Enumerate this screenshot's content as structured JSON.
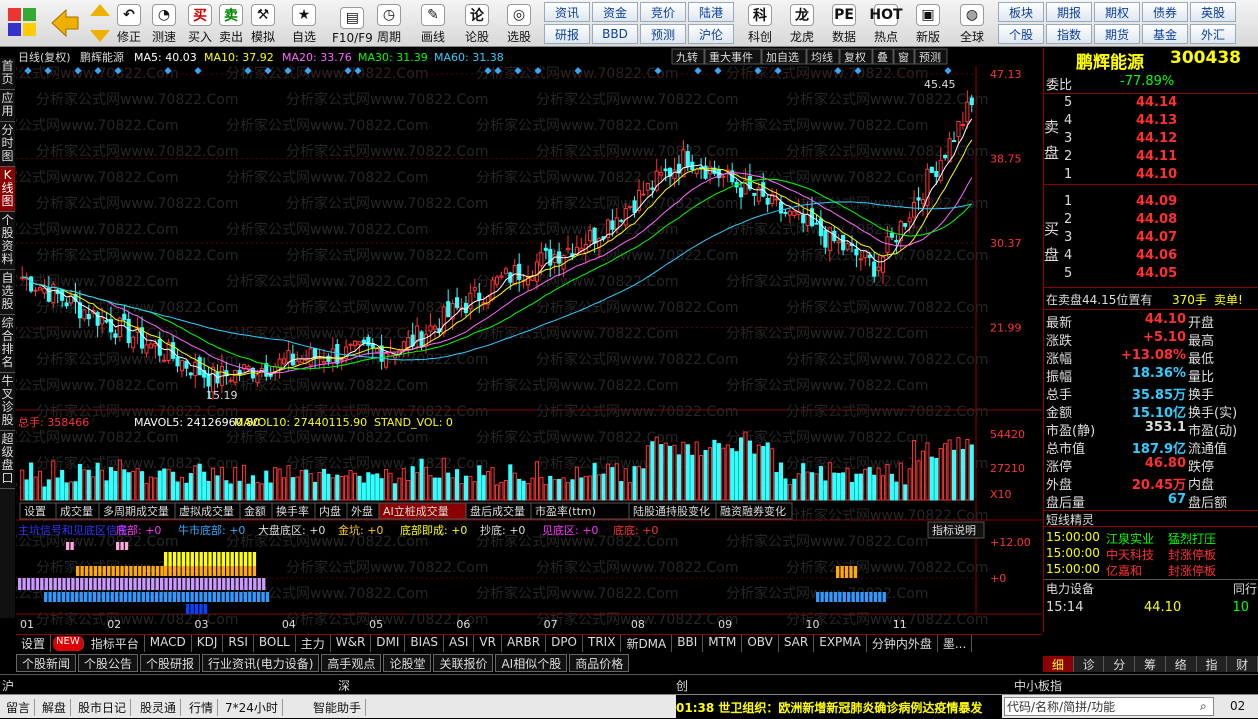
{
  "toolbar": {
    "buttons": [
      {
        "label": "修正",
        "icon": "undo-icon",
        "glyph": "↶",
        "x": 117
      },
      {
        "label": "测速",
        "icon": "speed-icon",
        "glyph": "◔",
        "x": 152
      },
      {
        "label": "买入",
        "icon": "buy-icon",
        "glyph": "买",
        "x": 188,
        "color": "#d00000"
      },
      {
        "label": "卖出",
        "icon": "sell-icon",
        "glyph": "卖",
        "x": 219,
        "color": "#008800"
      },
      {
        "label": "模拟",
        "icon": "simulate-icon",
        "glyph": "⚒",
        "x": 251
      },
      {
        "label": "自选",
        "icon": "watchlist-icon",
        "glyph": "★",
        "x": 292
      },
      {
        "label": "F10/F9",
        "icon": "f10-icon",
        "glyph": "▤",
        "x": 332
      },
      {
        "label": "周期",
        "icon": "period-icon",
        "glyph": "◷",
        "x": 377
      },
      {
        "label": "画线",
        "icon": "draw-icon",
        "glyph": "✎",
        "x": 421
      },
      {
        "label": "论股",
        "icon": "discuss-icon",
        "glyph": "论",
        "x": 465
      },
      {
        "label": "选股",
        "icon": "select-icon",
        "glyph": "◎",
        "x": 507
      },
      {
        "label": "科创",
        "icon": "kechuang-icon",
        "glyph": "科",
        "x": 748
      },
      {
        "label": "龙虎",
        "icon": "dragon-icon",
        "glyph": "龙",
        "x": 790
      },
      {
        "label": "数据",
        "icon": "data-icon",
        "glyph": "PE",
        "x": 832
      },
      {
        "label": "热点",
        "icon": "hot-icon",
        "glyph": "HOT",
        "x": 874
      },
      {
        "label": "新版",
        "icon": "new-version-icon",
        "glyph": "▣",
        "x": 916
      },
      {
        "label": "全球",
        "icon": "globe-icon",
        "glyph": "◍",
        "x": 960
      }
    ],
    "grid1": [
      "资讯",
      "资金",
      "竞价",
      "陆港",
      "研报",
      "BBD",
      "预测",
      "沪伦"
    ],
    "grid2": [
      "板块",
      "期报",
      "期权",
      "债券",
      "英股",
      "个股",
      "指数",
      "期货",
      "基金",
      "外汇"
    ]
  },
  "vtabs": [
    "首页",
    "应用",
    "分时图",
    "K线图",
    "个股资料",
    "自选股",
    "综合排名",
    "牛叉诊股",
    "超级盘口"
  ],
  "chart": {
    "info": {
      "label": "日线(复权)",
      "name": "鹏辉能源",
      "ma5": "MA5: 40.03",
      "ma10": "MA10: 37.92",
      "ma20": "MA20: 33.76",
      "ma30": "MA30: 31.39",
      "ma60": "MA60: 31.38"
    },
    "top_buttons": [
      "九转",
      "重大事件",
      "加自选",
      "均线",
      "复权",
      "叠",
      "窗",
      "预测"
    ],
    "price_ticks": [
      "47.13",
      "38.75",
      "30.37",
      "21.99"
    ],
    "high_label": "45.45",
    "low_label": "15.19",
    "vol_info": {
      "total": "总手: 358466",
      "mavol5": "MAVOL5: 24126960.80",
      "mavol10": "MAVOL10: 27440115.90",
      "stand": "STAND_VOL: 0"
    },
    "vol_ticks": [
      "54420",
      "27210",
      "X10"
    ],
    "vol_tabs": [
      "设置",
      "成交量",
      "多周期成交量",
      "虚拟成交量",
      "金额",
      "换手率",
      "内盘",
      "外盘",
      "AI立桩成交量",
      "盘后成交量",
      "市盈率(ttm)",
      "陆股通持股变化",
      "融资融券变化"
    ],
    "ind_info": {
      "title": "主坑信号和见底区信号",
      "dixi": "底部: +0",
      "niushi": "牛市底部: +0",
      "dapan": "大盘底区: +0",
      "jinkeng": "金坑: +0",
      "dibu": "底部即成: +0",
      "chaodi": "抄底: +0",
      "jiandi": "见底区: +0",
      "dipo": "底底: +0"
    },
    "ind_btn": "指标说明",
    "ind_ticks": [
      "+12.00",
      "+0"
    ],
    "x_labels": [
      "01",
      "02",
      "03",
      "04",
      "05",
      "06",
      "07",
      "08",
      "09",
      "10",
      "11"
    ]
  },
  "chart_data": {
    "type": "candlestick",
    "title": "鹏辉能源",
    "x": [
      "01",
      "02",
      "03",
      "04",
      "05",
      "06",
      "07",
      "08",
      "09",
      "10",
      "11"
    ],
    "close_monthly": [
      27.0,
      22.0,
      17.0,
      19.0,
      20.0,
      26.5,
      31.0,
      39.0,
      33.5,
      28.0,
      44.1
    ],
    "ylim": [
      15.19,
      47.13
    ],
    "ma_colors": {
      "ma5": "#ffffff",
      "ma10": "#ffff00",
      "ma20": "#ff66ff",
      "ma30": "#00ff00",
      "ma60": "#33ccff"
    }
  },
  "quote": {
    "name": "鹏辉能源",
    "code": "300438",
    "weibi_label": "委比",
    "weibi": "-77.89%",
    "sell_label": "卖盘",
    "buy_label": "买盘",
    "asks": [
      {
        "lvl": "5",
        "p": "44.14"
      },
      {
        "lvl": "4",
        "p": "44.13"
      },
      {
        "lvl": "3",
        "p": "44.12"
      },
      {
        "lvl": "2",
        "p": "44.11"
      },
      {
        "lvl": "1",
        "p": "44.10"
      }
    ],
    "bids": [
      {
        "lvl": "1",
        "p": "44.09"
      },
      {
        "lvl": "2",
        "p": "44.08"
      },
      {
        "lvl": "3",
        "p": "44.07"
      },
      {
        "lvl": "4",
        "p": "44.06"
      },
      {
        "lvl": "5",
        "p": "44.05"
      }
    ],
    "notice": "在卖盘44.15位置有",
    "notice_qty": "370手",
    "notice_tag": "卖单!",
    "stats": [
      {
        "l": "最新",
        "v": "44.10",
        "c": "#ff3030",
        "l2": "开盘"
      },
      {
        "l": "涨跌",
        "v": "+5.10",
        "c": "#ff3030",
        "l2": "最高"
      },
      {
        "l": "涨幅",
        "v": "+13.08%",
        "c": "#ff3030",
        "l2": "最低"
      },
      {
        "l": "振幅",
        "v": "18.36%",
        "c": "#33ccff",
        "l2": "量比"
      },
      {
        "l": "总手",
        "v": "35.85万",
        "c": "#33ccff",
        "l2": "换手"
      },
      {
        "l": "金额",
        "v": "15.10亿",
        "c": "#33ccff",
        "l2": "换手(实)"
      },
      {
        "l": "市盈(静)",
        "v": "353.1",
        "c": "#ddd",
        "l2": "市盈(动)"
      },
      {
        "l": "总市值",
        "v": "187.9亿",
        "c": "#33ccff",
        "l2": "流通值"
      },
      {
        "l": "涨停",
        "v": "46.80",
        "c": "#ff3030",
        "l2": "跌停"
      },
      {
        "l": "外盘",
        "v": "20.45万",
        "c": "#ff3030",
        "l2": "内盘"
      },
      {
        "l": "盘后量",
        "v": "67",
        "c": "#33ccff",
        "l2": "盘后额"
      }
    ],
    "news_title": "短线精灵",
    "news": [
      {
        "t": "15:00:00",
        "n": "江泉实业",
        "e": "猛烈打压",
        "c": "#00ff00"
      },
      {
        "t": "15:00:00",
        "n": "中天科技",
        "e": "封涨停板",
        "c": "#ff3030"
      },
      {
        "t": "15:00:00",
        "n": "亿嘉和",
        "e": "封涨停板",
        "c": "#ff3030"
      }
    ],
    "sector": "电力设备",
    "sector2": "同行",
    "tick": {
      "time": "15:14",
      "price": "44.10",
      "qty": "10"
    },
    "btabs": [
      "细",
      "诊",
      "分",
      "筹",
      "络",
      "指",
      "财"
    ]
  },
  "bottom": {
    "indicators": [
      "设置",
      "指标平台",
      "MACD",
      "KDJ",
      "RSI",
      "BOLL",
      "主力",
      "W&R",
      "DMI",
      "BIAS",
      "ASI",
      "VR",
      "ARBR",
      "DPO",
      "TRIX",
      "新DMA",
      "BBI",
      "MTM",
      "OBV",
      "SAR",
      "EXPMA",
      "分钟内外盘",
      "墨..."
    ],
    "new_badge": "NEW",
    "news_tabs": [
      "个股新闻",
      "个股公告",
      "个股研报",
      "行业资讯(电力设备)",
      "高手观点",
      "论股堂",
      "关联报价",
      "AI相似个股",
      "商品价格"
    ]
  },
  "status": {
    "sh": "沪",
    "sz": "深",
    "cy": "创",
    "right": "中小板指"
  },
  "foot": {
    "tabs": [
      "留言",
      "解盘",
      "股市日记",
      "股灵通",
      "行情",
      "7*24小时",
      "智能助手"
    ],
    "ticker": "01:38 世卫组织：欧洲新增新冠肺炎确诊病例达疫情暴发",
    "search_placeholder": "代码/名称/简拼/功能",
    "time": "02"
  },
  "watermark": "分析家公式网www.70822.Com"
}
